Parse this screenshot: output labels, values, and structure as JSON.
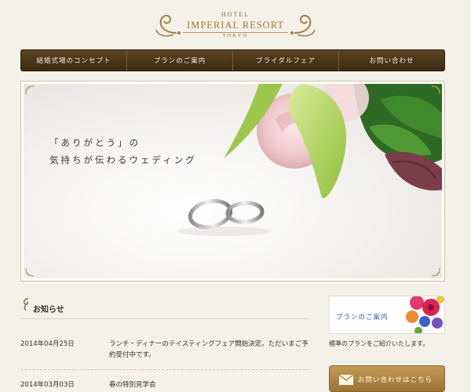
{
  "logo": {
    "hotel": "HOTEL",
    "brand": "IMPERIAL RESORT",
    "city": "TOKYO"
  },
  "nav": {
    "items": [
      {
        "label": "結婚式場のコンセプト"
      },
      {
        "label": "プランのご案内"
      },
      {
        "label": "ブライダルフェア"
      },
      {
        "label": "お問い合わせ"
      }
    ]
  },
  "hero": {
    "headline_line1": "「ありがとう」の",
    "headline_line2": "気持ちが伝わるウェディング"
  },
  "news": {
    "title": "お知らせ",
    "items": [
      {
        "date": "2014年04月25日",
        "text": "ランチ・ディナーのテイスティングフェア開始決定。ただいまご予約受付中です。"
      },
      {
        "date": "2014年03月03日",
        "text": "春の特別見学会"
      }
    ]
  },
  "sidebar": {
    "plan_banner_label": "プランのご案内",
    "plan_description": "標準のプランをご紹介いたします。",
    "contact_label": "お問い合わせはこちら"
  },
  "colors": {
    "nav_bg": "#4a3518",
    "accent_gold": "#a57d3c",
    "link_blue": "#2f5fa3",
    "page_bg": "#f3f1e9"
  }
}
